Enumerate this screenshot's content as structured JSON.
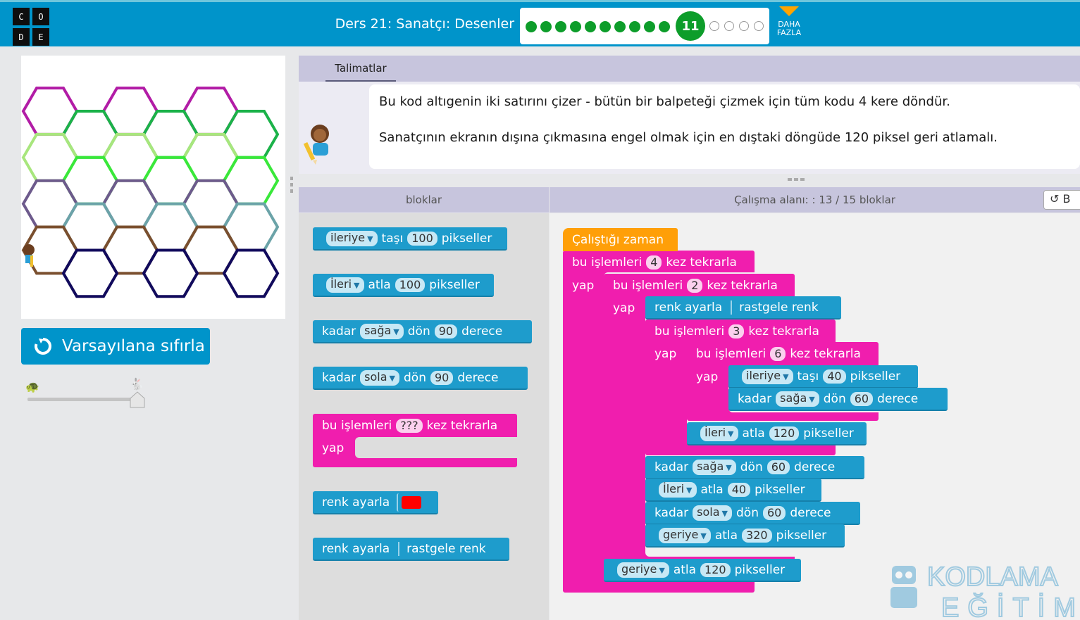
{
  "header": {
    "logo_letters": [
      "C",
      "O",
      "D",
      "E"
    ],
    "title": "Ders 21: Sanatçı: Desenler",
    "current_level": "11",
    "completed_levels": 10,
    "remaining_levels": 4,
    "more_label": "DAHA FAZLA"
  },
  "canvas": {
    "hex_colors": [
      "#b21ca6",
      "#1bb249",
      "#a8e67d",
      "#39e83a",
      "#6d5a8c",
      "#6ba3a8",
      "#7a4f2e",
      "#110a5c"
    ]
  },
  "controls": {
    "reset_label": "Varsayılana sıfırla",
    "speed_level": 1.0
  },
  "instructions": {
    "tab_label": "Talimatlar",
    "line1": "Bu kod altıgenin iki satırını çizer - bütün bir balpeteği çizmek için tüm kodu 4 kere döndür.",
    "line2": "Sanatçının ekranın dışına çıkmasına engel olmak için en dıştaki döngüde 120 piksel geri atlamalı."
  },
  "toolbox": {
    "header": "bloklar",
    "blocks": {
      "b1": {
        "dir": "ileriye",
        "verb": "taşı",
        "value": "100",
        "unit": "pikseller"
      },
      "b2": {
        "dir": "İleri",
        "verb": "atla",
        "value": "100",
        "unit": "pikseller"
      },
      "b3": {
        "pre": "kadar",
        "dir": "sağa",
        "verb": "dön",
        "value": "90",
        "unit": "derece"
      },
      "b4": {
        "pre": "kadar",
        "dir": "sola",
        "verb": "dön",
        "value": "90",
        "unit": "derece"
      },
      "b5": {
        "pre": "bu işlemleri",
        "value": "???",
        "post": "kez tekrarla",
        "do": "yap"
      },
      "b6": {
        "label": "renk ayarla"
      },
      "b7": {
        "label": "renk ayarla",
        "value": "rastgele renk"
      }
    }
  },
  "workspace": {
    "header": "Çalışma alanı: : 13 / 15 bloklar",
    "undo_label": "B",
    "when_run": "Çalıştığı zaman",
    "repeat_pre": "bu işlemleri",
    "repeat_post": "kez tekrarla",
    "do_label": "yap",
    "r1": "4",
    "r2": "2",
    "r3": "3",
    "r4": "6",
    "color_label": "renk ayarla",
    "color_value": "rastgele renk",
    "w1": {
      "dir": "ileriye",
      "verb": "taşı",
      "value": "40",
      "unit": "pikseller"
    },
    "w2": {
      "pre": "kadar",
      "dir": "sağa",
      "verb": "dön",
      "value": "60",
      "unit": "derece"
    },
    "w3": {
      "dir": "İleri",
      "verb": "atla",
      "value": "120",
      "unit": "pikseller"
    },
    "w4": {
      "pre": "kadar",
      "dir": "sağa",
      "verb": "dön",
      "value": "60",
      "unit": "derece"
    },
    "w5": {
      "dir": "İleri",
      "verb": "atla",
      "value": "40",
      "unit": "pikseller"
    },
    "w6": {
      "pre": "kadar",
      "dir": "sola",
      "verb": "dön",
      "value": "60",
      "unit": "derece"
    },
    "w7": {
      "dir": "geriye",
      "verb": "atla",
      "value": "320",
      "unit": "pikseller"
    },
    "w8": {
      "dir": "geriye",
      "verb": "atla",
      "value": "120",
      "unit": "pikseller"
    }
  },
  "watermark": {
    "line1": "KODLAMA",
    "line2": "EĞİTİMİ"
  }
}
